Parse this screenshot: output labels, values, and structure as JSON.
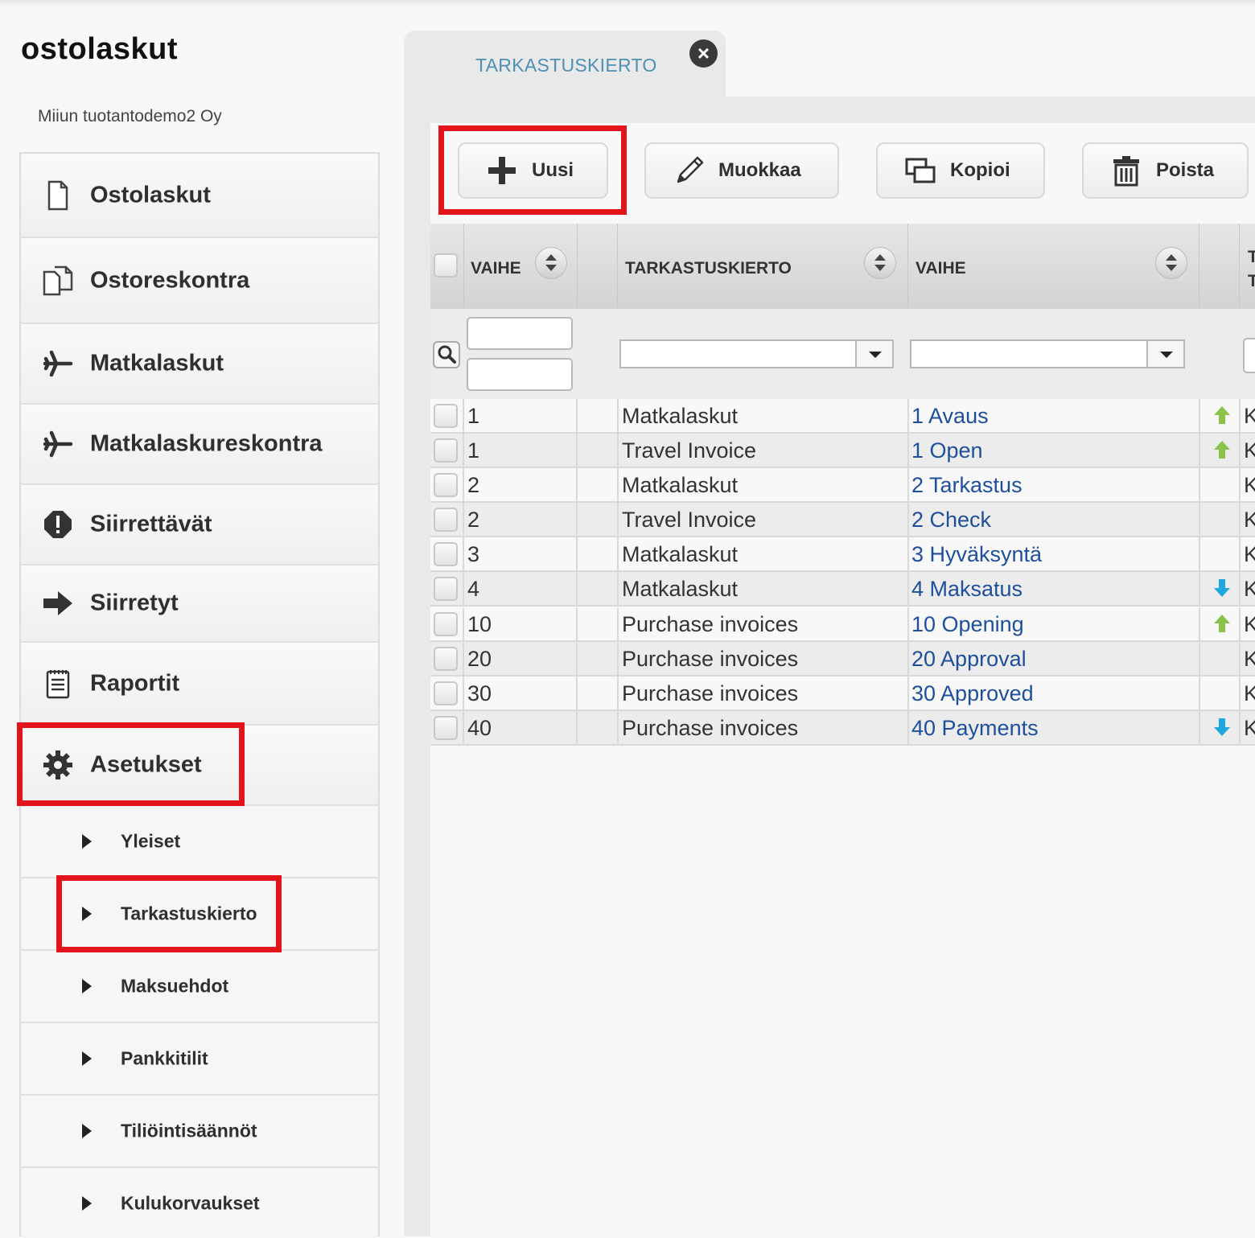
{
  "app": {
    "title": "ostolaskut",
    "company": "Miiun tuotantodemo2 Oy"
  },
  "sidebar": {
    "items": [
      {
        "label": "Ostolaskut",
        "icon": "document-icon"
      },
      {
        "label": "Ostoreskontra",
        "icon": "documents-icon"
      },
      {
        "label": "Matkalaskut",
        "icon": "airplane-icon"
      },
      {
        "label": "Matkalaskureskontra",
        "icon": "airplane-icon"
      },
      {
        "label": "Siirrettävät",
        "icon": "alert-icon"
      },
      {
        "label": "Siirretyt",
        "icon": "arrow-right-icon"
      },
      {
        "label": "Raportit",
        "icon": "report-icon"
      },
      {
        "label": "Asetukset",
        "icon": "gear-icon"
      }
    ],
    "subitems": [
      {
        "label": "Yleiset"
      },
      {
        "label": "Tarkastuskierto"
      },
      {
        "label": "Maksuehdot"
      },
      {
        "label": "Pankkitilit"
      },
      {
        "label": "Tiliöintisäännöt"
      },
      {
        "label": "Kulukorvaukset"
      }
    ]
  },
  "tab": {
    "label": "TARKASTUSKIERTO",
    "close_label": "×"
  },
  "toolbar": {
    "new_label": "Uusi",
    "edit_label": "Muokkaa",
    "copy_label": "Kopioi",
    "delete_label": "Poista"
  },
  "grid": {
    "columns": [
      "VAIHE",
      "TARKASTUSKIERTO",
      "VAIHE",
      "T"
    ],
    "last_column_partial": [
      "T",
      "T"
    ],
    "rows": [
      {
        "vaihe": "1",
        "kierto": "Matkalaskut",
        "nimi": "1 Avaus",
        "arrow": "up",
        "extra": "K"
      },
      {
        "vaihe": "1",
        "kierto": "Travel Invoice",
        "nimi": "1 Open",
        "arrow": "up",
        "extra": "K"
      },
      {
        "vaihe": "2",
        "kierto": "Matkalaskut",
        "nimi": "2 Tarkastus",
        "arrow": "",
        "extra": "K"
      },
      {
        "vaihe": "2",
        "kierto": "Travel Invoice",
        "nimi": "2 Check",
        "arrow": "",
        "extra": "K"
      },
      {
        "vaihe": "3",
        "kierto": "Matkalaskut",
        "nimi": "3 Hyväksyntä",
        "arrow": "",
        "extra": "K"
      },
      {
        "vaihe": "4",
        "kierto": "Matkalaskut",
        "nimi": "4 Maksatus",
        "arrow": "down",
        "extra": "K"
      },
      {
        "vaihe": "10",
        "kierto": "Purchase invoices",
        "nimi": "10 Opening",
        "arrow": "up",
        "extra": "K"
      },
      {
        "vaihe": "20",
        "kierto": "Purchase invoices",
        "nimi": "20 Approval",
        "arrow": "",
        "extra": "K"
      },
      {
        "vaihe": "30",
        "kierto": "Purchase invoices",
        "nimi": "30 Approved",
        "arrow": "",
        "extra": "K"
      },
      {
        "vaihe": "40",
        "kierto": "Purchase invoices",
        "nimi": "40 Payments",
        "arrow": "down",
        "extra": "K"
      }
    ]
  },
  "colors": {
    "highlight": "#e3141b",
    "link": "#1e4f9c",
    "arrow_up": "#8bc34a",
    "arrow_down": "#1ea7e1",
    "tab_text": "#4f8fb5"
  }
}
